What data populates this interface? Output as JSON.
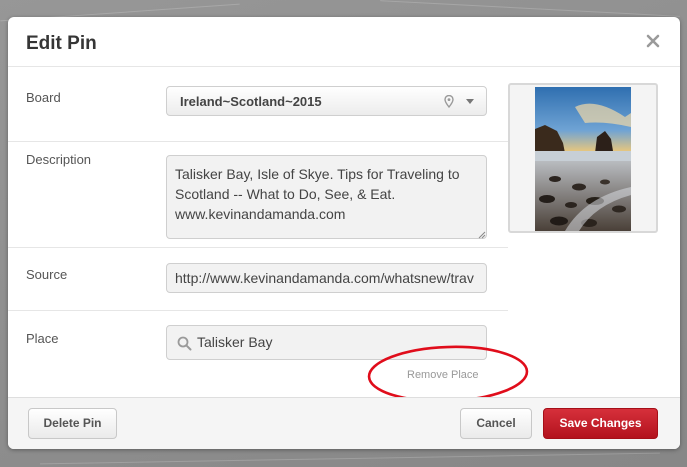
{
  "modal": {
    "title": "Edit Pin"
  },
  "form": {
    "board": {
      "label": "Board",
      "value": "Ireland~Scotland~2015"
    },
    "description": {
      "label": "Description",
      "value": "Talisker Bay, Isle of Skye. Tips for Traveling to\nScotland -- What to Do, See, & Eat.\nwww.kevinandamanda.com"
    },
    "source": {
      "label": "Source",
      "value": "http://www.kevinandamanda.com/whatsnew/trav"
    },
    "place": {
      "label": "Place",
      "value": "Talisker Bay",
      "remove_label": "Remove Place"
    }
  },
  "footer": {
    "delete_label": "Delete Pin",
    "cancel_label": "Cancel",
    "save_label": "Save Changes"
  },
  "colors": {
    "save_button": "#c41a24",
    "annotation_oval": "#e00d1b"
  },
  "icons": {
    "close": "close-icon",
    "board_location": "location-pin-icon",
    "board_dropdown": "chevron-down-icon",
    "place_search": "search-icon"
  }
}
